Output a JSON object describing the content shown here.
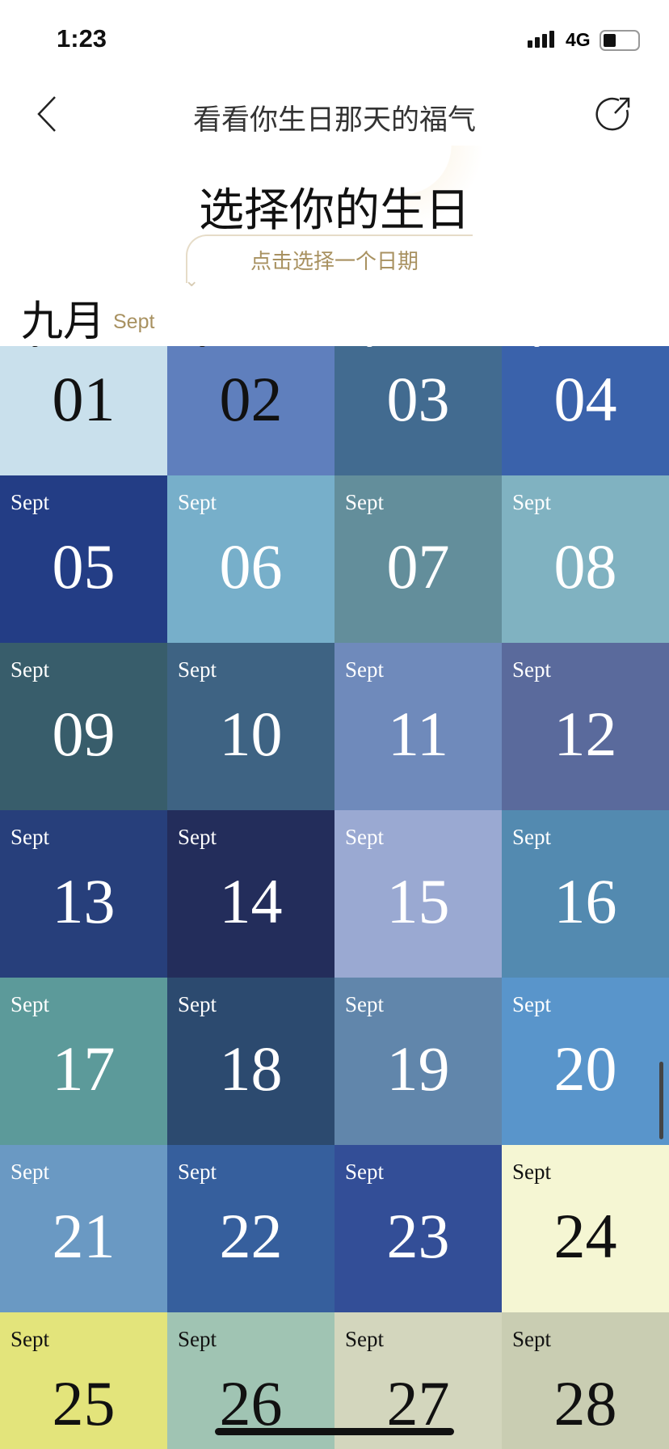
{
  "status": {
    "time": "1:23",
    "network": "4G",
    "battery_level": 0.35
  },
  "nav": {
    "title": "看看你生日那天的福气",
    "back_icon": "chevron-left-icon",
    "share_icon": "share-icon"
  },
  "header": {
    "title": "选择你的生日",
    "hint": "点击选择一个日期"
  },
  "month": {
    "zh": "九月",
    "en": "Sept"
  },
  "days": [
    {
      "m": "Sept",
      "d": "01",
      "bg": "#c9e0ec",
      "dark": true
    },
    {
      "m": "Sept",
      "d": "02",
      "bg": "#5f7fbd",
      "dark": true
    },
    {
      "m": "Sept",
      "d": "03",
      "bg": "#426b90"
    },
    {
      "m": "Sept",
      "d": "04",
      "bg": "#3a62ab"
    },
    {
      "m": "Sept",
      "d": "05",
      "bg": "#233d85"
    },
    {
      "m": "Sept",
      "d": "06",
      "bg": "#77afca"
    },
    {
      "m": "Sept",
      "d": "07",
      "bg": "#638e9b"
    },
    {
      "m": "Sept",
      "d": "08",
      "bg": "#80b2c1"
    },
    {
      "m": "Sept",
      "d": "09",
      "bg": "#385d6b"
    },
    {
      "m": "Sept",
      "d": "10",
      "bg": "#3e6383"
    },
    {
      "m": "Sept",
      "d": "11",
      "bg": "#6f8abb"
    },
    {
      "m": "Sept",
      "d": "12",
      "bg": "#5a6a9c"
    },
    {
      "m": "Sept",
      "d": "13",
      "bg": "#273f7b"
    },
    {
      "m": "Sept",
      "d": "14",
      "bg": "#232d5b"
    },
    {
      "m": "Sept",
      "d": "15",
      "bg": "#9aa9d2"
    },
    {
      "m": "Sept",
      "d": "16",
      "bg": "#538ab0"
    },
    {
      "m": "Sept",
      "d": "17",
      "bg": "#5c9a9a"
    },
    {
      "m": "Sept",
      "d": "18",
      "bg": "#2c4a6f"
    },
    {
      "m": "Sept",
      "d": "19",
      "bg": "#6186ab"
    },
    {
      "m": "Sept",
      "d": "20",
      "bg": "#5995cb"
    },
    {
      "m": "Sept",
      "d": "21",
      "bg": "#6a99c3"
    },
    {
      "m": "Sept",
      "d": "22",
      "bg": "#365f9d"
    },
    {
      "m": "Sept",
      "d": "23",
      "bg": "#334e97"
    },
    {
      "m": "Sept",
      "d": "24",
      "bg": "#f5f6d3",
      "dark": true
    },
    {
      "m": "Sept",
      "d": "25",
      "bg": "#e3e47b",
      "dark": true
    },
    {
      "m": "Sept",
      "d": "26",
      "bg": "#a0c4b3",
      "dark": true
    },
    {
      "m": "Sept",
      "d": "27",
      "bg": "#d3d6bd",
      "dark": true
    },
    {
      "m": "Sept",
      "d": "28",
      "bg": "#c9cdb2",
      "dark": true
    }
  ]
}
